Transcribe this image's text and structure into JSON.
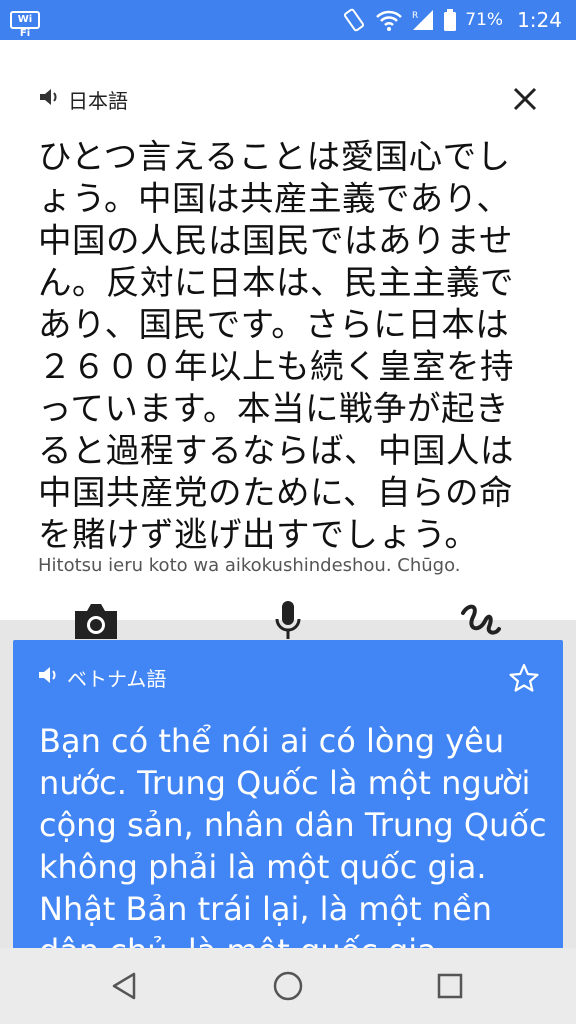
{
  "status_bar": {
    "wifi_badge": "Wi Fi",
    "battery": "71%",
    "time": "1:24",
    "icons": [
      "rotate-icon",
      "wifi-icon",
      "signal-icon",
      "battery-icon"
    ]
  },
  "source": {
    "language": "日本語",
    "text": "ひとつ言えることは愛国心でしょう。中国は共産主義であり、中国の人民は国民ではありません。反対に日本は、民主主義であり、国民です。さらに日本は２６００年以上も続く皇室を持っています。本当に戦争が起きると過程するならば、中国人は中国共産党のために、自らの命を賭けず逃げ出すでしょう。",
    "transliteration": "Hitotsu ieru koto wa aikokushindeshou. Chūgo.",
    "tools": [
      "camera-icon",
      "microphone-icon",
      "handwriting-icon"
    ]
  },
  "result": {
    "language": "ベトナム語",
    "text": "Bạn có thể nói ai có lòng yêu nước. Trung Quốc là một người cộng sản, nhân dân Trung Quốc không phải là một quốc gia. Nhật Bản trái lại, là một nền dân chủ, là một quốc gia"
  },
  "nav": [
    "back-icon",
    "home-icon",
    "recents-icon"
  ],
  "colors": {
    "accent": "#4285F4",
    "status_bar": "#3F81EE"
  }
}
